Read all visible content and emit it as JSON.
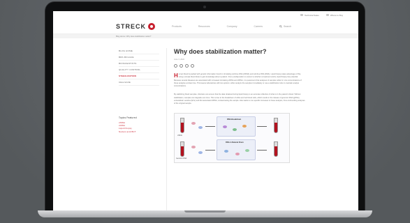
{
  "util": {
    "contact_label": "Technical Sales",
    "order_label": "Where to Buy"
  },
  "brand": {
    "name": "STRECK",
    "accent": "#c8202f"
  },
  "nav": {
    "items": [
      "Products",
      "Resources",
      "Company",
      "Careers"
    ],
    "search_label": "Search"
  },
  "breadcrumb": "Blog Home   /   Why does stabilization matter?",
  "sidebar": {
    "items": [
      "BLOG HOME",
      "BRK-BOLGUE",
      "BIOSCIENTISTS",
      "QUALITY CONTROL",
      "STABILIZATION",
      "CELLSAFE"
    ],
    "active_index": 4,
    "topics_title": "Topics Featured",
    "topics": [
      "cfDNA",
      "ctDNA",
      "Liquid biopsy",
      "Nucleic acid BCT"
    ]
  },
  "article": {
    "title": "Why does stabilization matter?",
    "date": "June 3, 2022",
    "dropcap": "H",
    "para1": "uman blood is packed with genetic information found in circulating cell-free DNA (cfDNA) and cell-free RNA (RNA). Liquid biopsy takes advantage of this, using a simple blood draw to gain knowledge about a patient. From predisposition to cancer to whether a treatment works, liquid biopsy has potential. Because several diseases are associated with increased circulating cfDNA and cfRNA, it is paramount that analyses of samples reflect in vivo concentrations of these analytes at draw time. This leaves laboratories with two options: either analyze the samples immediately or use a stabilization tube to maintain analyte concentrations.",
    "para2": "By stabilizing blood samples, clinicians can ensure that the data obtained during liquid biopsy is an accurate reflection of what is in the patient's blood. Without stabilization, samples can degrade over time. This is due to the breakdown of white and red blood cells, which results in the release of genomic DNA (gDNA), extracellular vesicles (EVs) and EV-associated cfRNA, contaminating the sample. Also leads to non-specific increases in these analytes, thus confounding analyses of the original sample.",
    "figure": {
      "top_label": "RNA Breakdown",
      "bottom_label": "RNA in Natural Drum",
      "left_top": "cfDNA",
      "left_bottom": "Genomic DNA"
    }
  }
}
